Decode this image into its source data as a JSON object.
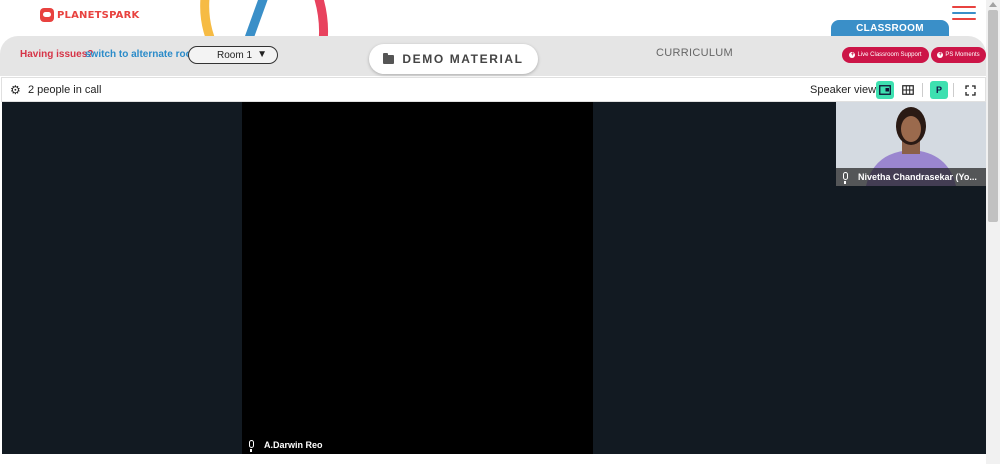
{
  "logo": {
    "text": "PLANETSPARK"
  },
  "menu": {
    "icon": "hamburger-icon",
    "colors": [
      "#e8423f",
      "#3a8fc8",
      "#e8423f"
    ]
  },
  "room": {
    "issues_label": "Having issues?",
    "switch_label": "switch to alternate room",
    "selected_room": "Room 1"
  },
  "demo_material": {
    "label": "DEMO MATERIAL",
    "icon": "folder-icon"
  },
  "curriculum_label": "CURRICULUM",
  "classroom_tab": "CLASSROOM",
  "buttons": {
    "live_support": "Live Classroom Support",
    "ps_moments": "PS Moments"
  },
  "call": {
    "settings_icon": "gear-icon",
    "people_count_text": "2 people in call",
    "view_label": "Speaker view",
    "presenter_badge": "P"
  },
  "participants": {
    "main": "A.Darwin Reo",
    "tile": "Nivetha Chandrasekar (Yo..."
  },
  "colors": {
    "accent_red": "#cc1547",
    "accent_blue": "#3a8fc8",
    "active_control": "#3ee0b0",
    "stage_bg": "#121a22"
  }
}
